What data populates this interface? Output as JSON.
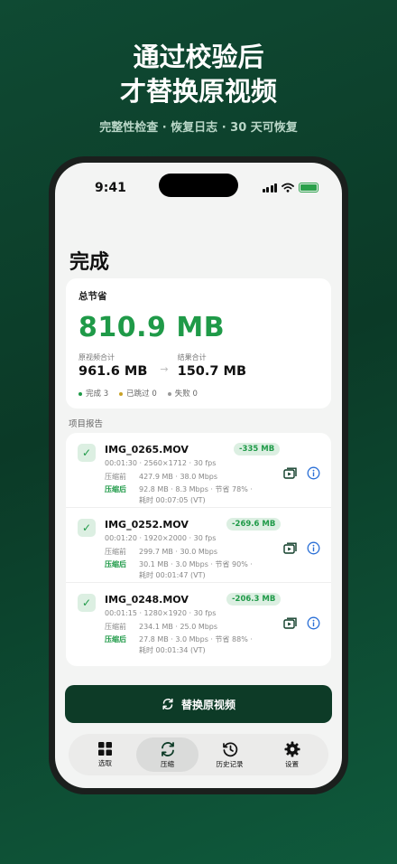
{
  "headline": {
    "line1": "通过校验后",
    "line2": "才替换原视频"
  },
  "subline": "完整性检查 · 恢复日志 · 30 天可恢复",
  "status_bar": {
    "time": "9:41"
  },
  "page_title": "完成",
  "summary": {
    "label": "总节省",
    "value": "810.9 MB",
    "original_caption": "原视频合计",
    "original_value": "961.6 MB",
    "result_caption": "结果合计",
    "result_value": "150.7 MB",
    "legend": [
      {
        "text": "完成 3",
        "color": "#1f9a48"
      },
      {
        "text": "已跳过 0",
        "color": "#c9a227"
      },
      {
        "text": "失败 0",
        "color": "#999999"
      }
    ]
  },
  "section_label": "项目报告",
  "items": [
    {
      "name": "IMG_0265.MOV",
      "saved": "-335 MB",
      "specs": "00:01:30 · 2560×1712 · 30 fps",
      "before_label": "压缩前",
      "before": "427.9 MB · 38.0 Mbps",
      "after_label": "压缩后",
      "after": "92.8 MB · 8.3 Mbps · 节省 78% ·",
      "elapsed": "耗时 00:07:05 (VT)"
    },
    {
      "name": "IMG_0252.MOV",
      "saved": "-269.6 MB",
      "specs": "00:01:20 · 1920×2000 · 30 fps",
      "before_label": "压缩前",
      "before": "299.7 MB · 30.0 Mbps",
      "after_label": "压缩后",
      "after": "30.1 MB · 3.0 Mbps · 节省 90% ·",
      "elapsed": "耗时 00:01:47 (VT)"
    },
    {
      "name": "IMG_0248.MOV",
      "saved": "-206.3 MB",
      "specs": "00:01:15 · 1280×1920 · 30 fps",
      "before_label": "压缩前",
      "before": "234.1 MB · 25.0 Mbps",
      "after_label": "压缩后",
      "after": "27.8 MB · 3.0 Mbps · 节省 88% ·",
      "elapsed": "耗时 00:01:34 (VT)"
    }
  ],
  "replace_button": "替换原视频",
  "tabs": [
    {
      "label": "选取",
      "icon": "grid-icon"
    },
    {
      "label": "压缩",
      "icon": "sync-icon"
    },
    {
      "label": "历史记录",
      "icon": "history-icon"
    },
    {
      "label": "设置",
      "icon": "gear-icon"
    }
  ],
  "colors": {
    "accent": "#1f9a48",
    "dark_green": "#0d3b27"
  }
}
